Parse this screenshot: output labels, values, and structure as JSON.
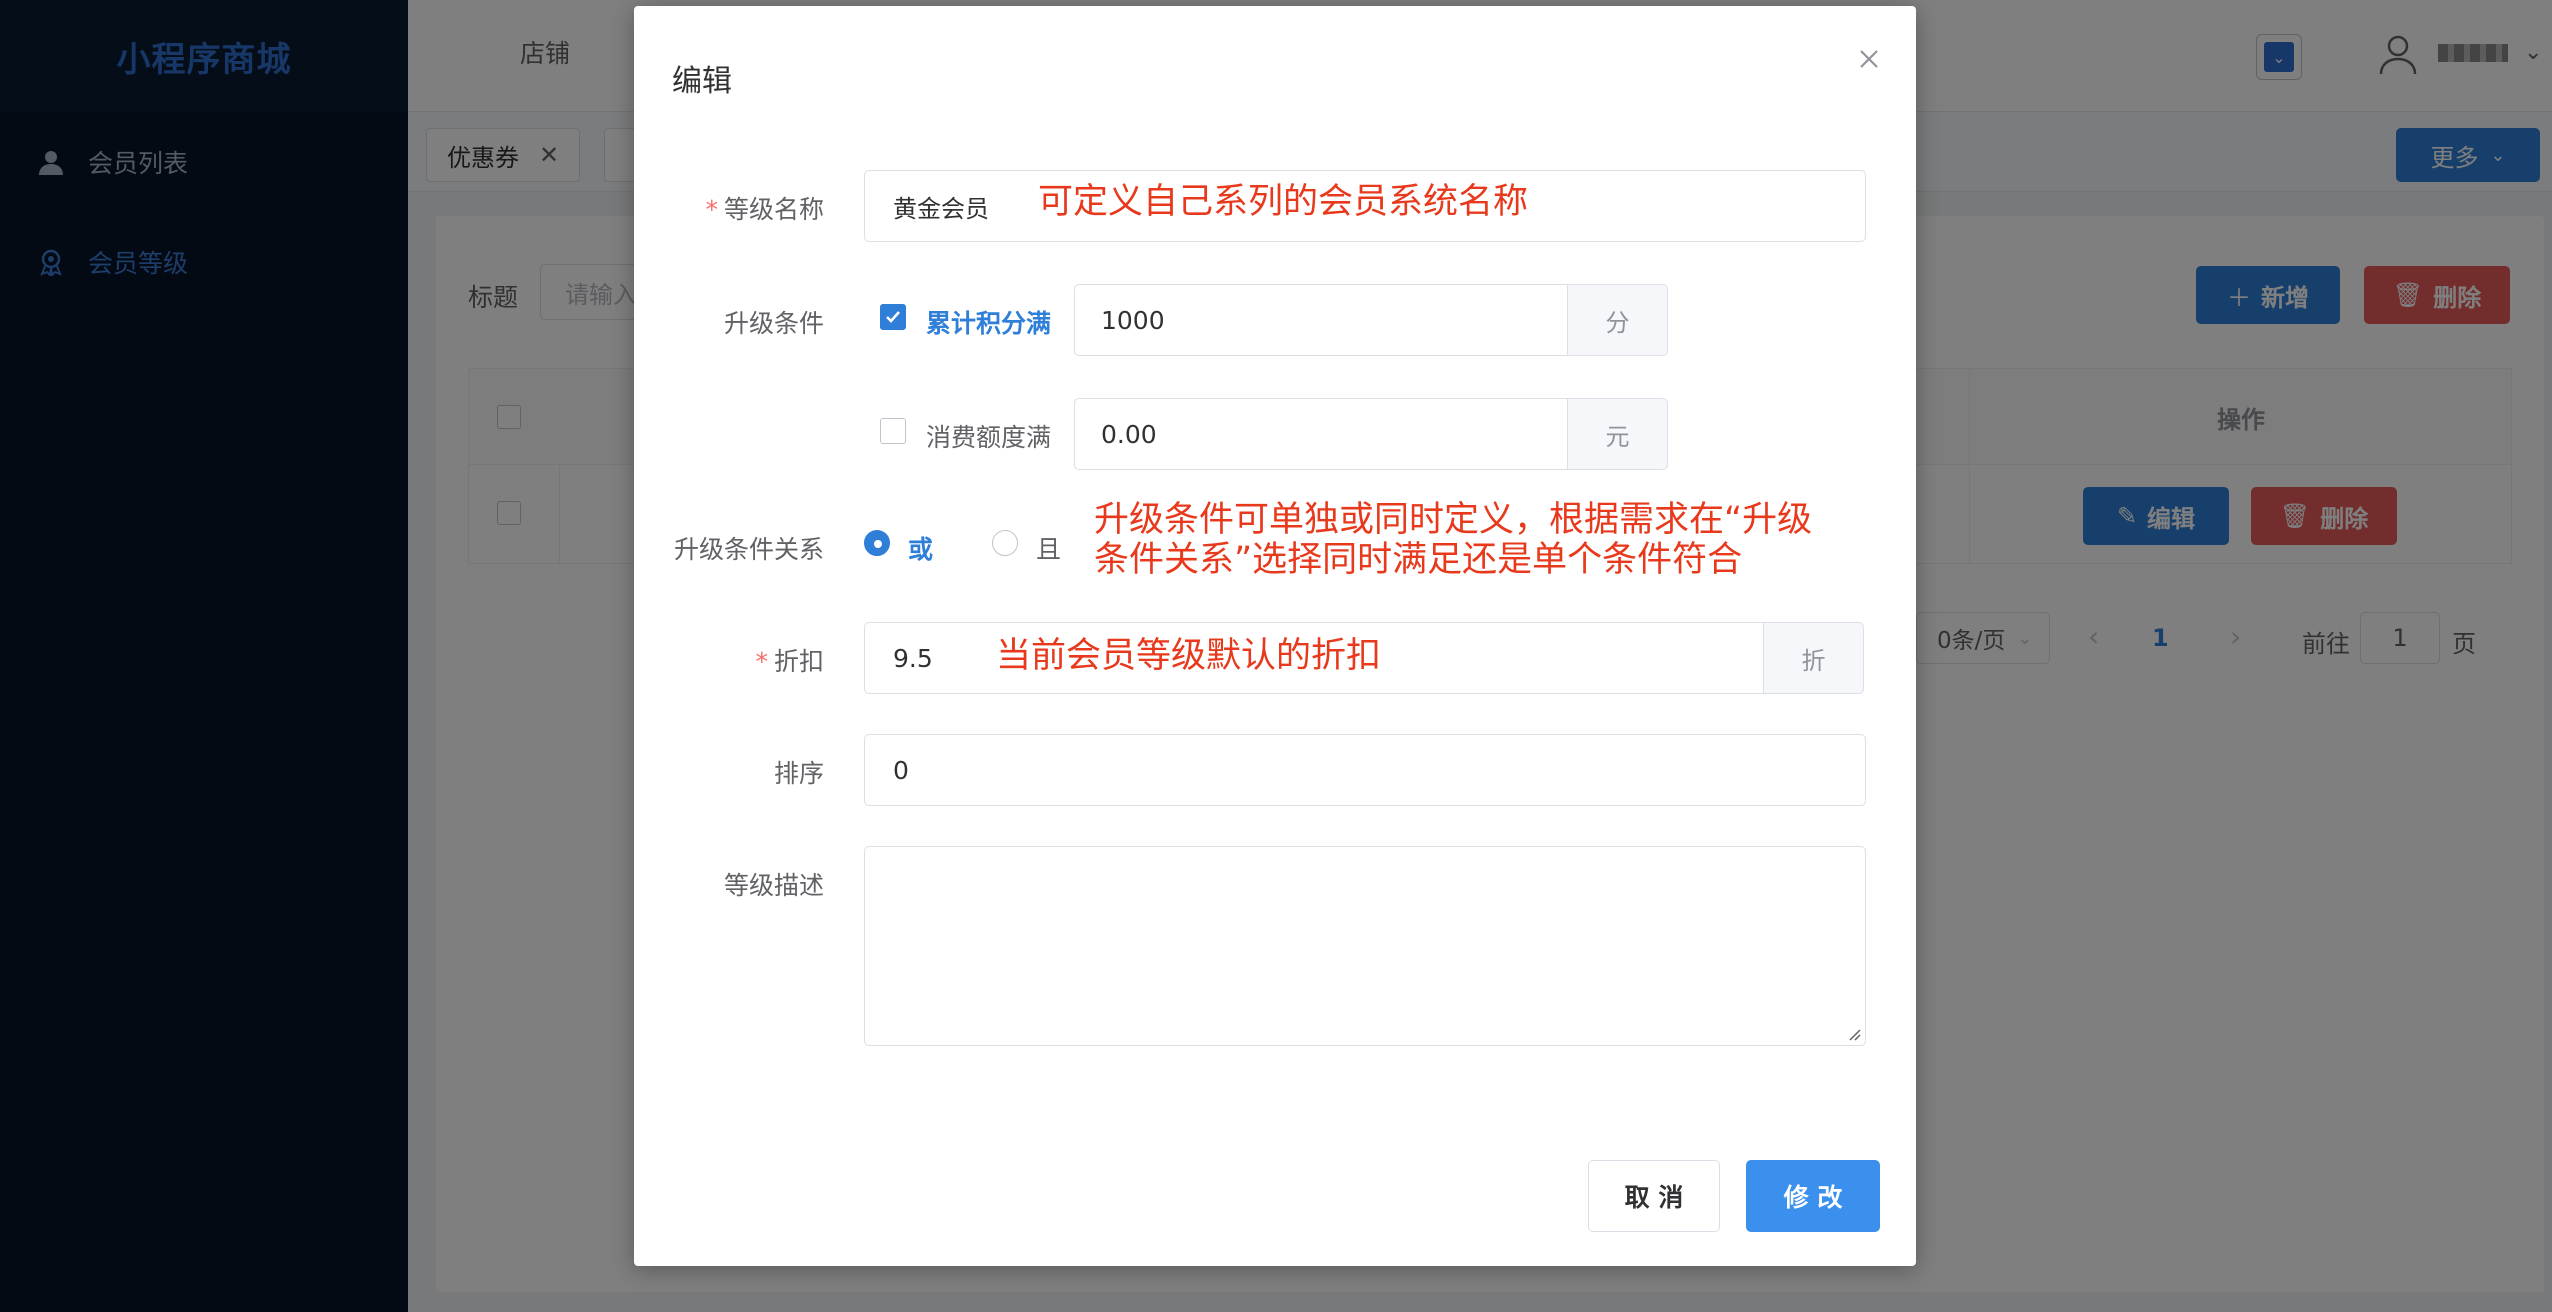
{
  "app": {
    "brand": "小程序商城"
  },
  "sidebar": {
    "items": [
      {
        "label": "会员列表"
      },
      {
        "label": "会员等级"
      }
    ]
  },
  "topbar": {
    "store_tab": "店铺"
  },
  "tags": {
    "coupon": "优惠券",
    "more": "更多"
  },
  "list": {
    "filter_label": "标题",
    "filter_placeholder": "请输入",
    "add_label": "新增",
    "delete_label": "删除",
    "op_header": "操作",
    "row_edit": "编辑",
    "row_delete": "删除",
    "page_size": "0条/页",
    "current_page": "1",
    "goto_label": "前往",
    "goto_value": "1",
    "page_suffix": "页"
  },
  "dialog": {
    "title": "编辑",
    "level_name": {
      "label": "等级名称",
      "value": "黄金会员",
      "note": "可定义自己系列的会员系统名称"
    },
    "upgrade": {
      "label": "升级条件",
      "points": {
        "label": "累计积分满",
        "checked": true,
        "value": "1000",
        "unit": "分"
      },
      "spend": {
        "label": "消费额度满",
        "checked": false,
        "value": "0.00",
        "unit": "元"
      }
    },
    "relation": {
      "label": "升级条件关系",
      "or_label": "或",
      "and_label": "且",
      "selected": "或",
      "note_line1": "升级条件可单独或同时定义，根据需求在“升级",
      "note_line2": "条件关系”选择同时满足还是单个条件符合"
    },
    "discount": {
      "label": "折扣",
      "value": "9.5",
      "unit": "折",
      "note": "当前会员等级默认的折扣"
    },
    "sort": {
      "label": "排序",
      "value": "0"
    },
    "description": {
      "label": "等级描述",
      "value": ""
    },
    "cancel_label": "取 消",
    "submit_label": "修 改"
  },
  "colors": {
    "primary": "#2f7fd9",
    "danger": "#e85a5a",
    "annotation": "#e8391c",
    "sidebar_bg": "#061426"
  }
}
